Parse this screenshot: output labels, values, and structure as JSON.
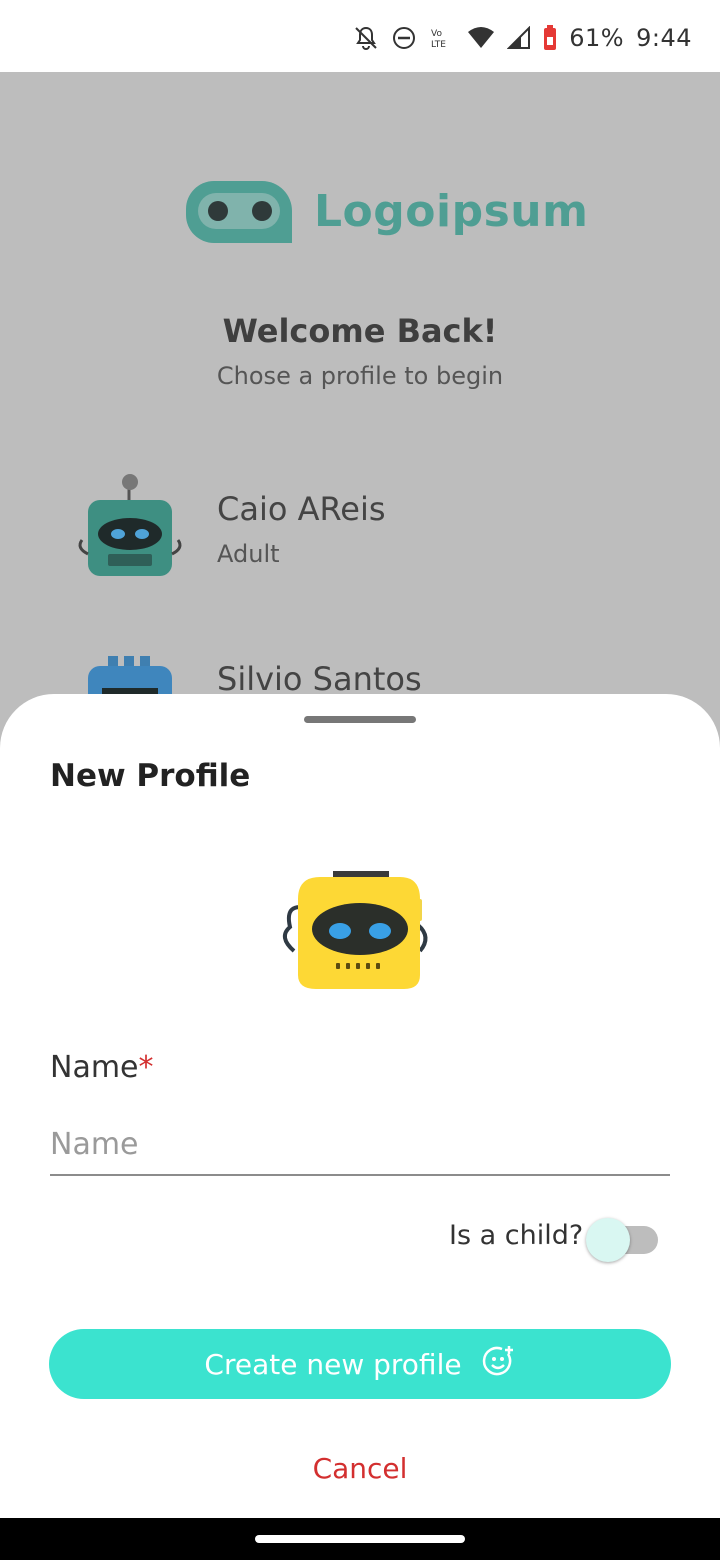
{
  "status_bar": {
    "battery": "61%",
    "time": "9:44",
    "icons": [
      "bell-off-icon",
      "do-not-disturb-icon",
      "volte-icon",
      "wifi-icon",
      "signal-icon",
      "battery-icon"
    ]
  },
  "logo": {
    "text": "Logoipsum",
    "color": "#4f9e93"
  },
  "welcome": {
    "title": "Welcome Back!",
    "subtitle": "Chose a profile to begin"
  },
  "profiles": [
    {
      "name": "Caio AReis",
      "role": "Adult",
      "avatar": "green-robot-avatar"
    },
    {
      "name": "Silvio Santos",
      "role": "",
      "avatar": "blue-robot-avatar"
    }
  ],
  "sheet": {
    "title": "New Profile",
    "avatar": "yellow-robot-avatar",
    "name_label": "Name",
    "required_mark": "*",
    "name_placeholder": "Name",
    "name_value": "",
    "child_label": "Is a child?",
    "child_toggle_on": false,
    "create_button": "Create new profile",
    "create_icon": "smile-plus-icon",
    "cancel": "Cancel"
  },
  "colors": {
    "accent": "#3be3cf",
    "danger": "#d32f2f",
    "overlay": "#bdbdbd"
  }
}
